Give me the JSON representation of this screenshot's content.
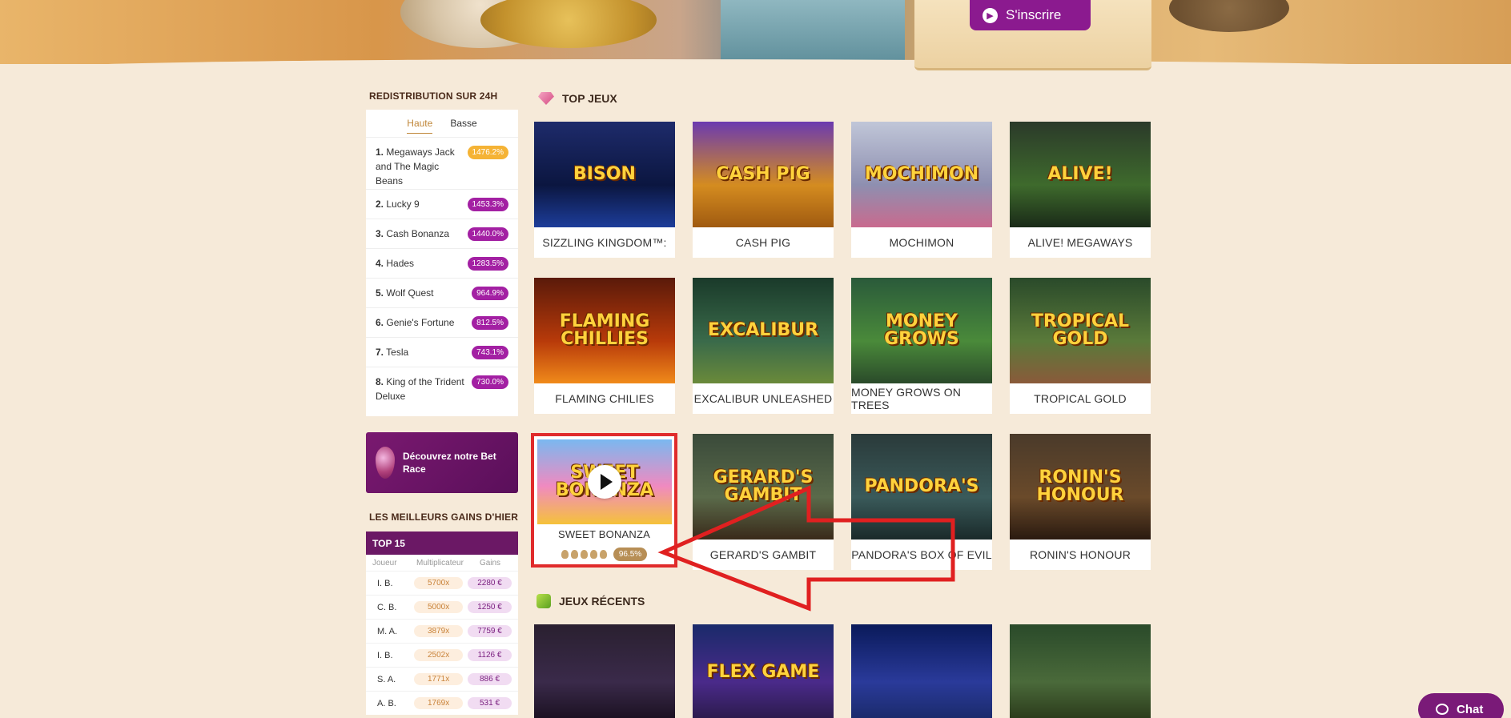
{
  "header": {
    "signup_label": "S'inscrire",
    "signup_icon": "chevron-right-icon"
  },
  "rtp": {
    "title": "REDISTRIBUTION SUR 24H",
    "tabs": [
      "Haute",
      "Basse"
    ],
    "active_tab": "Haute",
    "items": [
      {
        "rank": "1.",
        "name": "Megaways Jack and The Magic Beans",
        "pct": "1476.2%",
        "color": "#f5b335"
      },
      {
        "rank": "2.",
        "name": "Lucky 9",
        "pct": "1453.3%",
        "color": "#a320a3"
      },
      {
        "rank": "3.",
        "name": "Cash Bonanza",
        "pct": "1440.0%",
        "color": "#a320a3"
      },
      {
        "rank": "4.",
        "name": "Hades",
        "pct": "1283.5%",
        "color": "#a320a3"
      },
      {
        "rank": "5.",
        "name": "Wolf Quest",
        "pct": "964.9%",
        "color": "#a320a3"
      },
      {
        "rank": "6.",
        "name": "Genie's Fortune",
        "pct": "812.5%",
        "color": "#a320a3"
      },
      {
        "rank": "7.",
        "name": "Tesla",
        "pct": "743.1%",
        "color": "#a320a3"
      },
      {
        "rank": "8.",
        "name": "King of the Trident Deluxe",
        "pct": "730.0%",
        "color": "#a320a3"
      }
    ]
  },
  "betrace": {
    "text": "Découvrez notre Bet Race"
  },
  "wins": {
    "title": "LES MEILLEURS GAINS D'HIER",
    "header": "TOP 15",
    "columns": [
      "Joueur",
      "Multiplicateur",
      "Gains"
    ],
    "rows": [
      {
        "player": "I. B.",
        "mult": "5700x",
        "gain": "2280 €"
      },
      {
        "player": "C. B.",
        "mult": "5000x",
        "gain": "1250 €"
      },
      {
        "player": "M. A.",
        "mult": "3879x",
        "gain": "7759 €"
      },
      {
        "player": "I. B.",
        "mult": "2502x",
        "gain": "1126 €"
      },
      {
        "player": "S. A.",
        "mult": "1771x",
        "gain": "886 €"
      },
      {
        "player": "A. B.",
        "mult": "1769x",
        "gain": "531 €"
      }
    ]
  },
  "top_games": {
    "title": "TOP JEUX",
    "games": [
      {
        "label": "SIZZLING KINGDOM™:",
        "art": "BISON",
        "bg": "linear-gradient(180deg,#1e2b6b,#0b1640 60%,#1d3d9a)"
      },
      {
        "label": "CASH PIG",
        "art": "CASH PIG",
        "bg": "linear-gradient(180deg,#6b3ab0,#d48c20 60%,#a05a10)"
      },
      {
        "label": "MOCHIMON",
        "art": "MOCHIMON",
        "bg": "linear-gradient(180deg,#c0c6d8,#8e8fb0 60%,#c96a8e)"
      },
      {
        "label": "ALIVE! MEGAWAYS",
        "art": "ALIVE!",
        "bg": "linear-gradient(180deg,#2b3a2a,#3e6a2c 60%,#1a2a18)"
      },
      {
        "label": "FLAMING CHILIES",
        "art": "FLAMING CHILLIES",
        "bg": "linear-gradient(180deg,#5a1a0a,#b83a0a 60%,#f08a1a)"
      },
      {
        "label": "EXCALIBUR UNLEASHED",
        "art": "EXCALIBUR",
        "bg": "linear-gradient(180deg,#1a3a2a,#3a6a4a 60%,#6a8a3a)"
      },
      {
        "label": "MONEY GROWS ON TREES",
        "art": "MONEY GROWS",
        "bg": "linear-gradient(180deg,#2a5a3a,#4a8a3a 60%,#2a4a2a)"
      },
      {
        "label": "TROPICAL GOLD",
        "art": "TROPICAL GOLD",
        "bg": "linear-gradient(180deg,#2a4a2a,#5a7a3a 60%,#8a5a3a)"
      },
      {
        "label": "GERARD'S GAMBIT",
        "art": "GERARD'S GAMBIT",
        "bg": "linear-gradient(180deg,#3a4a3a,#5a6a4a 60%,#3a2a1a)"
      },
      {
        "label": "PANDORA'S BOX OF EVIL",
        "art": "PANDORA'S",
        "bg": "linear-gradient(180deg,#2a3a3a,#3a5a5a 60%,#1a2a2a)"
      },
      {
        "label": "RONIN'S HONOUR",
        "art": "RONIN'S HONOUR",
        "bg": "linear-gradient(180deg,#4a3a2a,#6a4a2a 60%,#2a1a10)"
      }
    ],
    "featured": {
      "label": "SWEET BONANZA",
      "art": "SWEET BONANZA",
      "rtp": "96.5%",
      "volatility": 5
    }
  },
  "recent_games": {
    "title": "JEUX RÉCENTS",
    "games": [
      {
        "art": "",
        "bg": "linear-gradient(180deg,#2a2030,#3a2a4a 60%,#1a1020)"
      },
      {
        "art": "FLEX GAME",
        "bg": "linear-gradient(180deg,#1a2a6a,#4a2a8a 60%,#2a1a4a)"
      },
      {
        "art": "",
        "bg": "linear-gradient(180deg,#0a1a5a,#2a3a9a 60%,#1a2a6a)"
      },
      {
        "art": "",
        "bg": "linear-gradient(180deg,#2a4a2a,#4a6a3a 60%,#2a3a1a)"
      }
    ]
  },
  "chat": {
    "label": "Chat"
  }
}
